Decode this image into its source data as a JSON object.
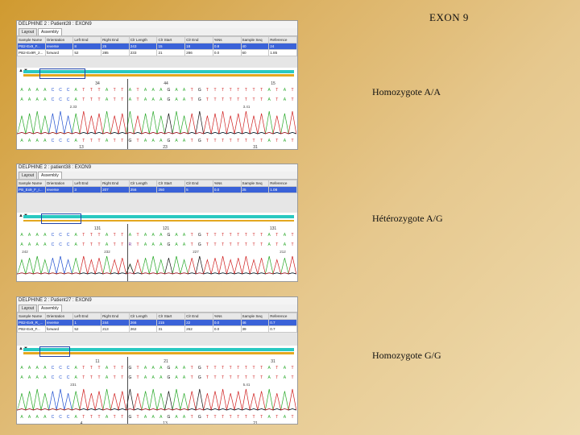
{
  "slide": {
    "title": "EXON 9",
    "labels": [
      "Homozygote A/A",
      "Hétérozygote A/G",
      "Homozygote G/G"
    ]
  },
  "columns": [
    "Sample Name",
    "Orientation",
    "Left End",
    "Right End",
    "Clr Length",
    "Clr Start",
    "Clr End",
    "%Ns",
    "Sample Seq",
    "Reference"
  ],
  "colors": {
    "A": "#27a827",
    "C": "#2050d0",
    "G": "#111111",
    "T": "#d02020",
    "selection": "#3a62d8",
    "track": "#29c9c1",
    "track2": "#e4a820"
  },
  "panels": [
    {
      "title": "DELPHINE 2 : Patient28 : EXON9",
      "tabs": [
        "Layout",
        "Assembly"
      ],
      "rows": [
        [
          "PB2-Ex9_F...",
          "reverse",
          "8",
          "25",
          "243",
          "15",
          "18",
          "0.8",
          "40",
          "24"
        ],
        [
          "PB2-Ex9R_2...",
          "forward",
          "52",
          "285",
          "233",
          "21",
          "286",
          "0.0",
          "60",
          "1.85"
        ]
      ],
      "positions_top": [
        "34",
        "44",
        "15"
      ],
      "ruler": [
        "2.33",
        "3.41"
      ],
      "positions_bottom": [
        "13",
        "23",
        "31"
      ],
      "seq1": "AAAACCCATTTATTATAAAGAATGTTTTTTTTATAT",
      "seq2": "AAAACCCATTTATTATAAAGAATGTTTTTTTTATAT",
      "seq3": "AAAACCCATTTATTGTAAAGAATGTTTTTTTTATAT"
    },
    {
      "title": "DELPHINE 2 : patient38 : EXON9",
      "tabs": [
        "Layout",
        "Assembly"
      ],
      "rows": [
        [
          "PB_Ex9_F_r...",
          "reverse",
          "3",
          "207",
          "256",
          "250",
          "5",
          "0.0",
          "25",
          "1.08"
        ]
      ],
      "positions_top": [
        "131",
        "121",
        "131"
      ],
      "ruler": [
        "242",
        "232",
        "227",
        "212"
      ],
      "positions_bottom": [],
      "seq1": "AAAACCCATTTATTATAAAGAATGTTTTTTTTATAT",
      "seq2": "AAAACCCATTTATTRTAAAGAATGTTTTTTTTATAT",
      "seq3": ""
    },
    {
      "title": "DELPHINE 2 : Patient27 : EXON9",
      "tabs": [
        "Layout",
        "Assembly"
      ],
      "rows": [
        [
          "PB2-Ex9_R_...",
          "reverse",
          "1",
          "244",
          "266",
          "215",
          "22",
          "0.0",
          "46",
          "0.7"
        ],
        [
          "PB2-Ex9_F...",
          "forward",
          "52",
          "213",
          "262",
          "31",
          "262",
          "0.0",
          "39",
          "0.7"
        ]
      ],
      "positions_top": [
        "11",
        "21",
        "31"
      ],
      "ruler": [
        "231",
        "5.41"
      ],
      "positions_bottom": [
        "4",
        "13",
        "21"
      ],
      "seq1": "AAAACCCATTTATTGTAAAGAATGTTTTTTTTATAT",
      "seq2": "AAAACCCATTTATTGTAAAGAATGTTTTTTTTATAT",
      "seq3": "AAAACCCATTTATTGTAAAGAATGTTTTTTTTATAT"
    }
  ]
}
